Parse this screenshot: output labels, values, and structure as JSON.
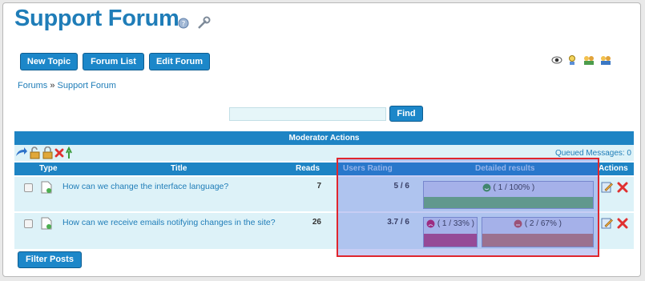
{
  "header": {
    "title": "Support Forum"
  },
  "buttons": {
    "new_topic": "New Topic",
    "forum_list": "Forum List",
    "edit_forum": "Edit Forum"
  },
  "breadcrumb": {
    "forums": "Forums",
    "sep": "»",
    "current": "Support Forum"
  },
  "search": {
    "value": "",
    "find_label": "Find"
  },
  "moderator": {
    "title": "Moderator Actions",
    "queued": "Queued Messages: 0"
  },
  "table": {
    "columns": {
      "type": "Type",
      "title": "Title",
      "reads": "Reads",
      "rating": "Users Rating",
      "detailed": "Detailed results",
      "actions": "Actions"
    },
    "rows": [
      {
        "title": "How can we change the interface language?",
        "reads": "7",
        "rating": "5 / 6",
        "results": [
          {
            "label": "( 1 / 100% )",
            "sentiment": "positive",
            "color": "#6db36d",
            "face_color": "#3f9a3f"
          }
        ]
      },
      {
        "title": "How can we receive emails notifying changes in the site?",
        "reads": "26",
        "rating": "3.7 / 6",
        "results": [
          {
            "label": "( 1 / 33% )",
            "sentiment": "negative",
            "color": "#b8447a",
            "face_color": "#c2185b"
          },
          {
            "label": "( 2 / 67% )",
            "sentiment": "neutral",
            "color": "#c07b6f",
            "face_color": "#c0504d"
          }
        ]
      }
    ]
  },
  "footer": {
    "filter_label": "Filter Posts"
  },
  "colors": {
    "brand_blue": "#1f7db8",
    "button_blue": "#1c87c9",
    "row_bg": "#ddf2f8",
    "highlight_border": "#e0262e"
  }
}
